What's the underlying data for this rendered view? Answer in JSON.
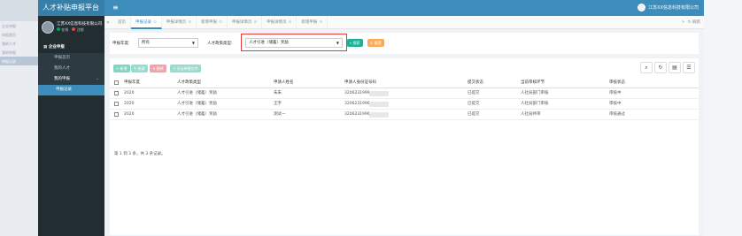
{
  "background_menu": [
    "企业申报",
    "申报首页",
    "我的人才",
    "我的申报",
    "申报记录"
  ],
  "header": {
    "app_title": "人才补贴申报平台",
    "menu_icon": "menu-icon",
    "company": "江苏XX信息科技有限公司"
  },
  "sidebar": {
    "user_name": "江苏XX信息科技有限公司",
    "online_label": "在线",
    "logout_label": "注销",
    "menu": {
      "section": "企业申报",
      "home": "申报首页",
      "my_talent": "我的人才",
      "my_application": "我的申报",
      "records": "申报记录"
    }
  },
  "tabs": {
    "items": [
      {
        "label": "首页",
        "closable": false
      },
      {
        "label": "申报记录",
        "closable": true,
        "active": true
      },
      {
        "label": "申报详情页",
        "closable": true
      },
      {
        "label": "新增申报",
        "closable": true
      },
      {
        "label": "申报详情页",
        "closable": true
      },
      {
        "label": "申报详情页",
        "closable": true
      },
      {
        "label": "新增申报",
        "closable": true
      }
    ],
    "close_glyph": "⊙",
    "refresh_label": "刷新"
  },
  "filter": {
    "year_label": "申报年度:",
    "year_value": "所有",
    "type_label": "人才政策类型:",
    "type_value": "人才引进（储蓄）奖励",
    "search_button": "搜索",
    "reset_button": "重置"
  },
  "toolbar": {
    "add": "+ 新增",
    "edit": "修改",
    "delete": "删除",
    "export": "导出申报文件"
  },
  "table": {
    "columns": [
      "申报年度",
      "人才政策类型",
      "申请人姓名",
      "申请人身份证号码",
      "提交状态",
      "当前审核环节",
      "审核状态"
    ],
    "rows": [
      [
        "2020",
        "人才引进（储蓄）奖励",
        "朱朱",
        "3206231999",
        "已提交",
        "人社局部门审核",
        "审核中"
      ],
      [
        "2020",
        "人才引进（储蓄）奖励",
        "王宇",
        "3206231996",
        "已提交",
        "人社局部门审核",
        "审核中"
      ],
      [
        "2020",
        "人才引进（储蓄）奖励",
        "测试一",
        "3206231996",
        "已提交",
        "人社局终审",
        "审核通过"
      ]
    ],
    "footer": "第 1 到 3 条，共 3 条记录。"
  },
  "colors": {
    "header_blue": "#3c8dbc",
    "sidebar_dark": "#222d32",
    "search_green": "#1ab394",
    "reset_orange": "#f8ac59",
    "highlight_red": "#e53935"
  }
}
